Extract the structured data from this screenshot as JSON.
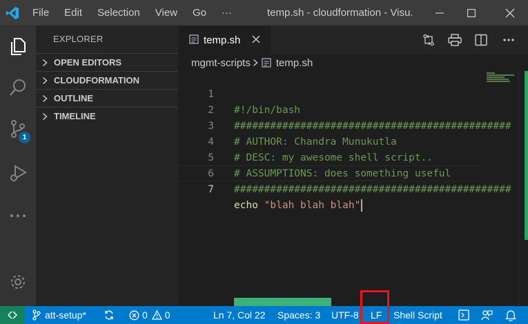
{
  "titlebar": {
    "menu": [
      "File",
      "Edit",
      "Selection",
      "View",
      "Go",
      "···"
    ],
    "window_title": "temp.sh - cloudformation - Visu..."
  },
  "activity_bar": {
    "items": [
      "explorer-icon",
      "search-icon",
      "source-control-icon",
      "run-debug-icon",
      "more-icon",
      "gear-icon"
    ],
    "source_control_badge": "1"
  },
  "sidebar": {
    "title": "EXPLORER",
    "sections": [
      "OPEN EDITORS",
      "CLOUDFORMATION",
      "OUTLINE",
      "TIMELINE"
    ]
  },
  "editor": {
    "tab": {
      "label": "temp.sh"
    },
    "breadcrumb": [
      "mgmt-scripts",
      "temp.sh"
    ],
    "lines": [
      {
        "number": "1",
        "text": "#!/bin/bash"
      },
      {
        "number": "2",
        "text": "##############################################"
      },
      {
        "number": "3",
        "text": "# AUTHOR: Chandra Munukutla"
      },
      {
        "number": "4",
        "text": "# DESC: my awesome shell script.."
      },
      {
        "number": "5",
        "text": "# ASSUMPTIONS: does something useful"
      },
      {
        "number": "6",
        "text": "##############################################"
      },
      {
        "number": "7",
        "keyword": "echo",
        "string": "\"blah blah blah\""
      }
    ]
  },
  "statusbar": {
    "branch": "att-setup*",
    "errors": "0",
    "warnings": "0",
    "position": "Ln 7, Col 22",
    "indentation": "Spaces: 3",
    "encoding": "UTF-8",
    "eol": "LF",
    "language": "Shell Script"
  },
  "colors": {
    "statusbar": "#007acc",
    "remote": "#16825d",
    "comment": "#6a9955",
    "string": "#ce9178",
    "highlight": "#e8161c"
  }
}
